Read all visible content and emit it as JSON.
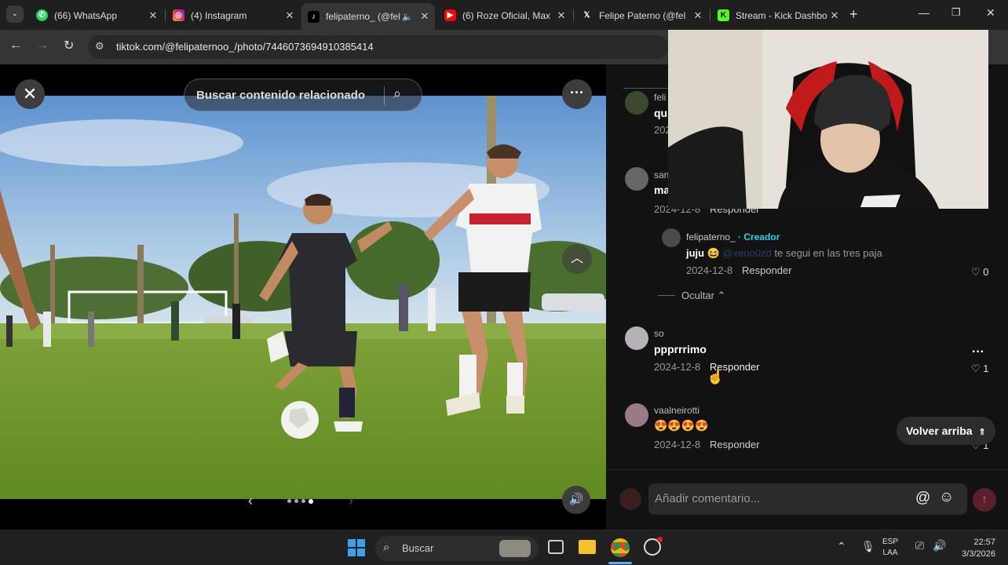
{
  "browser": {
    "tabs": [
      {
        "label": "(66) WhatsApp",
        "icon": "whatsapp-icon",
        "color": "#25d366"
      },
      {
        "label": "(4) Instagram",
        "icon": "instagram-icon",
        "color": "#e1306c"
      },
      {
        "label": "felipaterno_ (@fel",
        "icon": "tiktok-icon",
        "color": "#ffffff"
      },
      {
        "label": "(6) Roze Oficial, Max",
        "icon": "youtube-icon",
        "color": "#ff0000"
      },
      {
        "label": "Felipe Paterno (@fel",
        "icon": "x-icon",
        "color": "#ffffff"
      },
      {
        "label": "Stream - Kick Dashbo",
        "icon": "kick-icon",
        "color": "#53fc18"
      }
    ],
    "url": "tiktok.com/@felipaternoo_/photo/7446073694910385414"
  },
  "viewer": {
    "search_placeholder": "Buscar contenido relacionado",
    "dots_total": 4,
    "dot_active": 4
  },
  "comments": [
    {
      "user": "feli",
      "text": "qu",
      "date": "2024"
    },
    {
      "user": "san",
      "text": "ma",
      "date": "2024-12-8",
      "reply": "Responder"
    },
    {
      "user": "felipaterno_",
      "creator_tag": "· Creador",
      "text": "juju",
      "mention": "@xeno0zd",
      "rest": "te segui en las tres paja",
      "date": "2024-12-8",
      "reply": "Responder",
      "likes": "0"
    },
    {
      "user": "so",
      "text": "ppprrrimo",
      "date": "2024-12-8",
      "reply": "Responder",
      "likes": "1"
    },
    {
      "user": "vaalneirotti",
      "text": "😍😍😍😍",
      "date": "2024-12-8",
      "reply": "Responder",
      "likes": "1"
    }
  ],
  "hide_label": "Ocultar",
  "back_to_top": "Volver arriba",
  "add_comment_placeholder": "Añadir comentario...",
  "taskbar": {
    "search": "Buscar",
    "lang_top": "ESP",
    "lang_bottom": "LAA",
    "time": "22:57",
    "date": "3/3/2026"
  }
}
